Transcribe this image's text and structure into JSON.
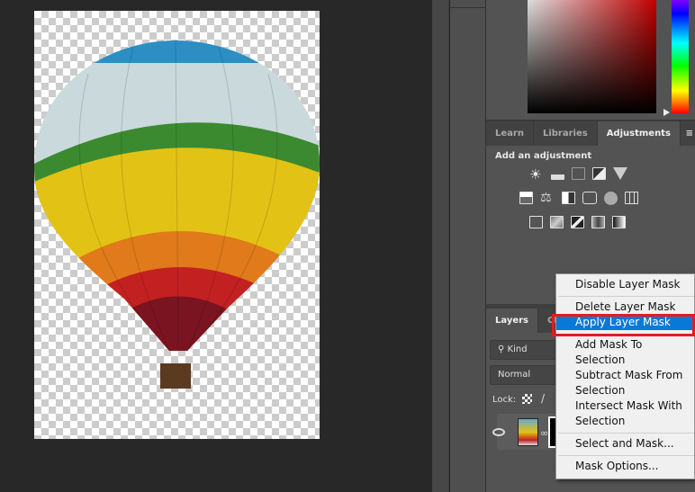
{
  "adjustments_panel": {
    "tabs": [
      {
        "label": "Learn"
      },
      {
        "label": "Libraries"
      },
      {
        "label": "Adjustments",
        "active": true
      }
    ],
    "menu_icon": "hamburger-icon",
    "title": "Add an adjustment",
    "icons_row1": [
      "brightness-contrast-icon",
      "levels-icon",
      "curves-icon",
      "exposure-icon",
      "vibrance-icon"
    ],
    "icons_row2": [
      "hue-saturation-icon",
      "color-balance-icon",
      "black-white-icon",
      "photo-filter-icon",
      "channel-mixer-icon",
      "color-lookup-icon"
    ],
    "icons_row3": [
      "invert-icon",
      "posterize-icon",
      "threshold-icon",
      "selective-color-icon",
      "gradient-map-icon"
    ]
  },
  "layers_panel": {
    "tabs": [
      {
        "label": "Layers",
        "active": true
      },
      {
        "label": "Cha"
      }
    ],
    "filter": "Kind",
    "blend_mode": "Normal",
    "lock_label": "Lock:"
  },
  "context_menu": {
    "items": [
      {
        "label": "Disable Layer Mask"
      },
      {
        "label": "Delete Layer Mask"
      },
      {
        "label": "Apply Layer Mask",
        "selected": true
      },
      {
        "label": "Add Mask To Selection"
      },
      {
        "label": "Subtract Mask From Selection"
      },
      {
        "label": "Intersect Mask With Selection"
      },
      {
        "label": "Select and Mask..."
      },
      {
        "label": "Mask Options..."
      }
    ],
    "highlight_color": "#0a78d7",
    "annotation_color": "#e41b23"
  }
}
